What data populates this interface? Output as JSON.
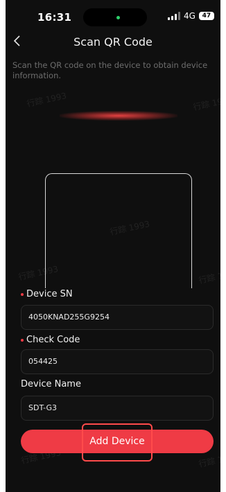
{
  "status": {
    "time": "16:31",
    "network": "4G",
    "battery": "47"
  },
  "header": {
    "title": "Scan QR Code"
  },
  "hint": "Scan the QR code on the device to obtain device information.",
  "watermark": "行踪 1993",
  "form": {
    "device_sn_label": "Device SN",
    "device_sn_value": "4050KNAD255G9254",
    "check_code_label": "Check Code",
    "check_code_value": "054425",
    "device_name_label": "Device Name",
    "device_name_value": "SDT-G3"
  },
  "actions": {
    "add_device": "Add Device"
  },
  "colors": {
    "accent": "#ef3b45",
    "background": "#0f0f0f"
  }
}
